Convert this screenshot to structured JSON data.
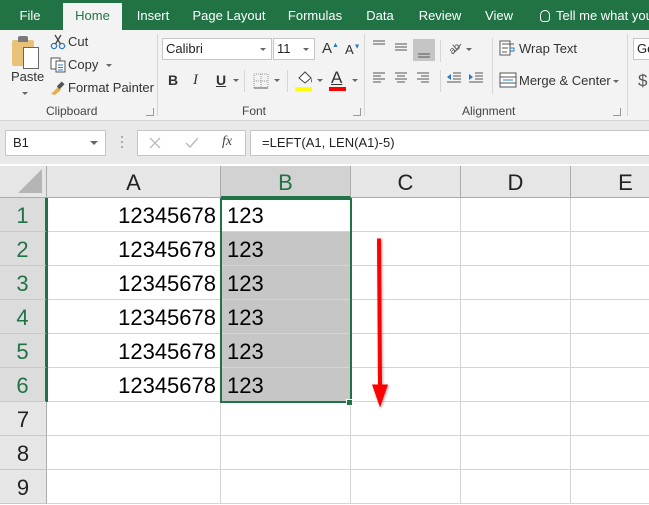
{
  "ribbon_tabs": [
    {
      "label": "File",
      "active": false
    },
    {
      "label": "Home",
      "active": true
    },
    {
      "label": "Insert",
      "active": false
    },
    {
      "label": "Page Layout",
      "active": false
    },
    {
      "label": "Formulas",
      "active": false
    },
    {
      "label": "Data",
      "active": false
    },
    {
      "label": "Review",
      "active": false
    },
    {
      "label": "View",
      "active": false
    }
  ],
  "tell_me": "Tell me what you",
  "clipboard": {
    "paste": "Paste",
    "cut": "Cut",
    "copy": "Copy",
    "format_painter": "Format Painter",
    "group_label": "Clipboard"
  },
  "font": {
    "family": "Calibri",
    "size": "11",
    "bold": "B",
    "italic": "I",
    "underline": "U",
    "font_color_glyph": "A",
    "highlight_color": "#ffff00",
    "font_color": "#ff0000",
    "group_label": "Font"
  },
  "alignment": {
    "wrap_text": "Wrap Text",
    "merge_center": "Merge & Center",
    "group_label": "Alignment"
  },
  "number": {
    "format_value": "Ge",
    "currency_glyph": "$"
  },
  "formula_bar": {
    "name_box": "B1",
    "fx": "fx",
    "formula": "=LEFT(A1, LEN(A1)-5)"
  },
  "sheet": {
    "columns": [
      "A",
      "B",
      "C",
      "D",
      "E"
    ],
    "selected_column": "B",
    "rows": [
      "1",
      "2",
      "3",
      "4",
      "5",
      "6",
      "7",
      "8",
      "9"
    ],
    "selected_rows": [
      "1",
      "2",
      "3",
      "4",
      "5",
      "6"
    ],
    "cells": {
      "A": [
        "12345678",
        "12345678",
        "12345678",
        "12345678",
        "12345678",
        "12345678",
        "",
        "",
        ""
      ],
      "B": [
        "123",
        "123",
        "123",
        "123",
        "123",
        "123",
        "",
        "",
        ""
      ]
    },
    "active_cell": "B1",
    "selection_range": "B1:B6"
  },
  "annotation": {
    "arrow_direction": "down",
    "arrow_color": "#ff0000"
  },
  "theme": {
    "accent": "#217346",
    "selection_fill": "#c6c6c6"
  }
}
